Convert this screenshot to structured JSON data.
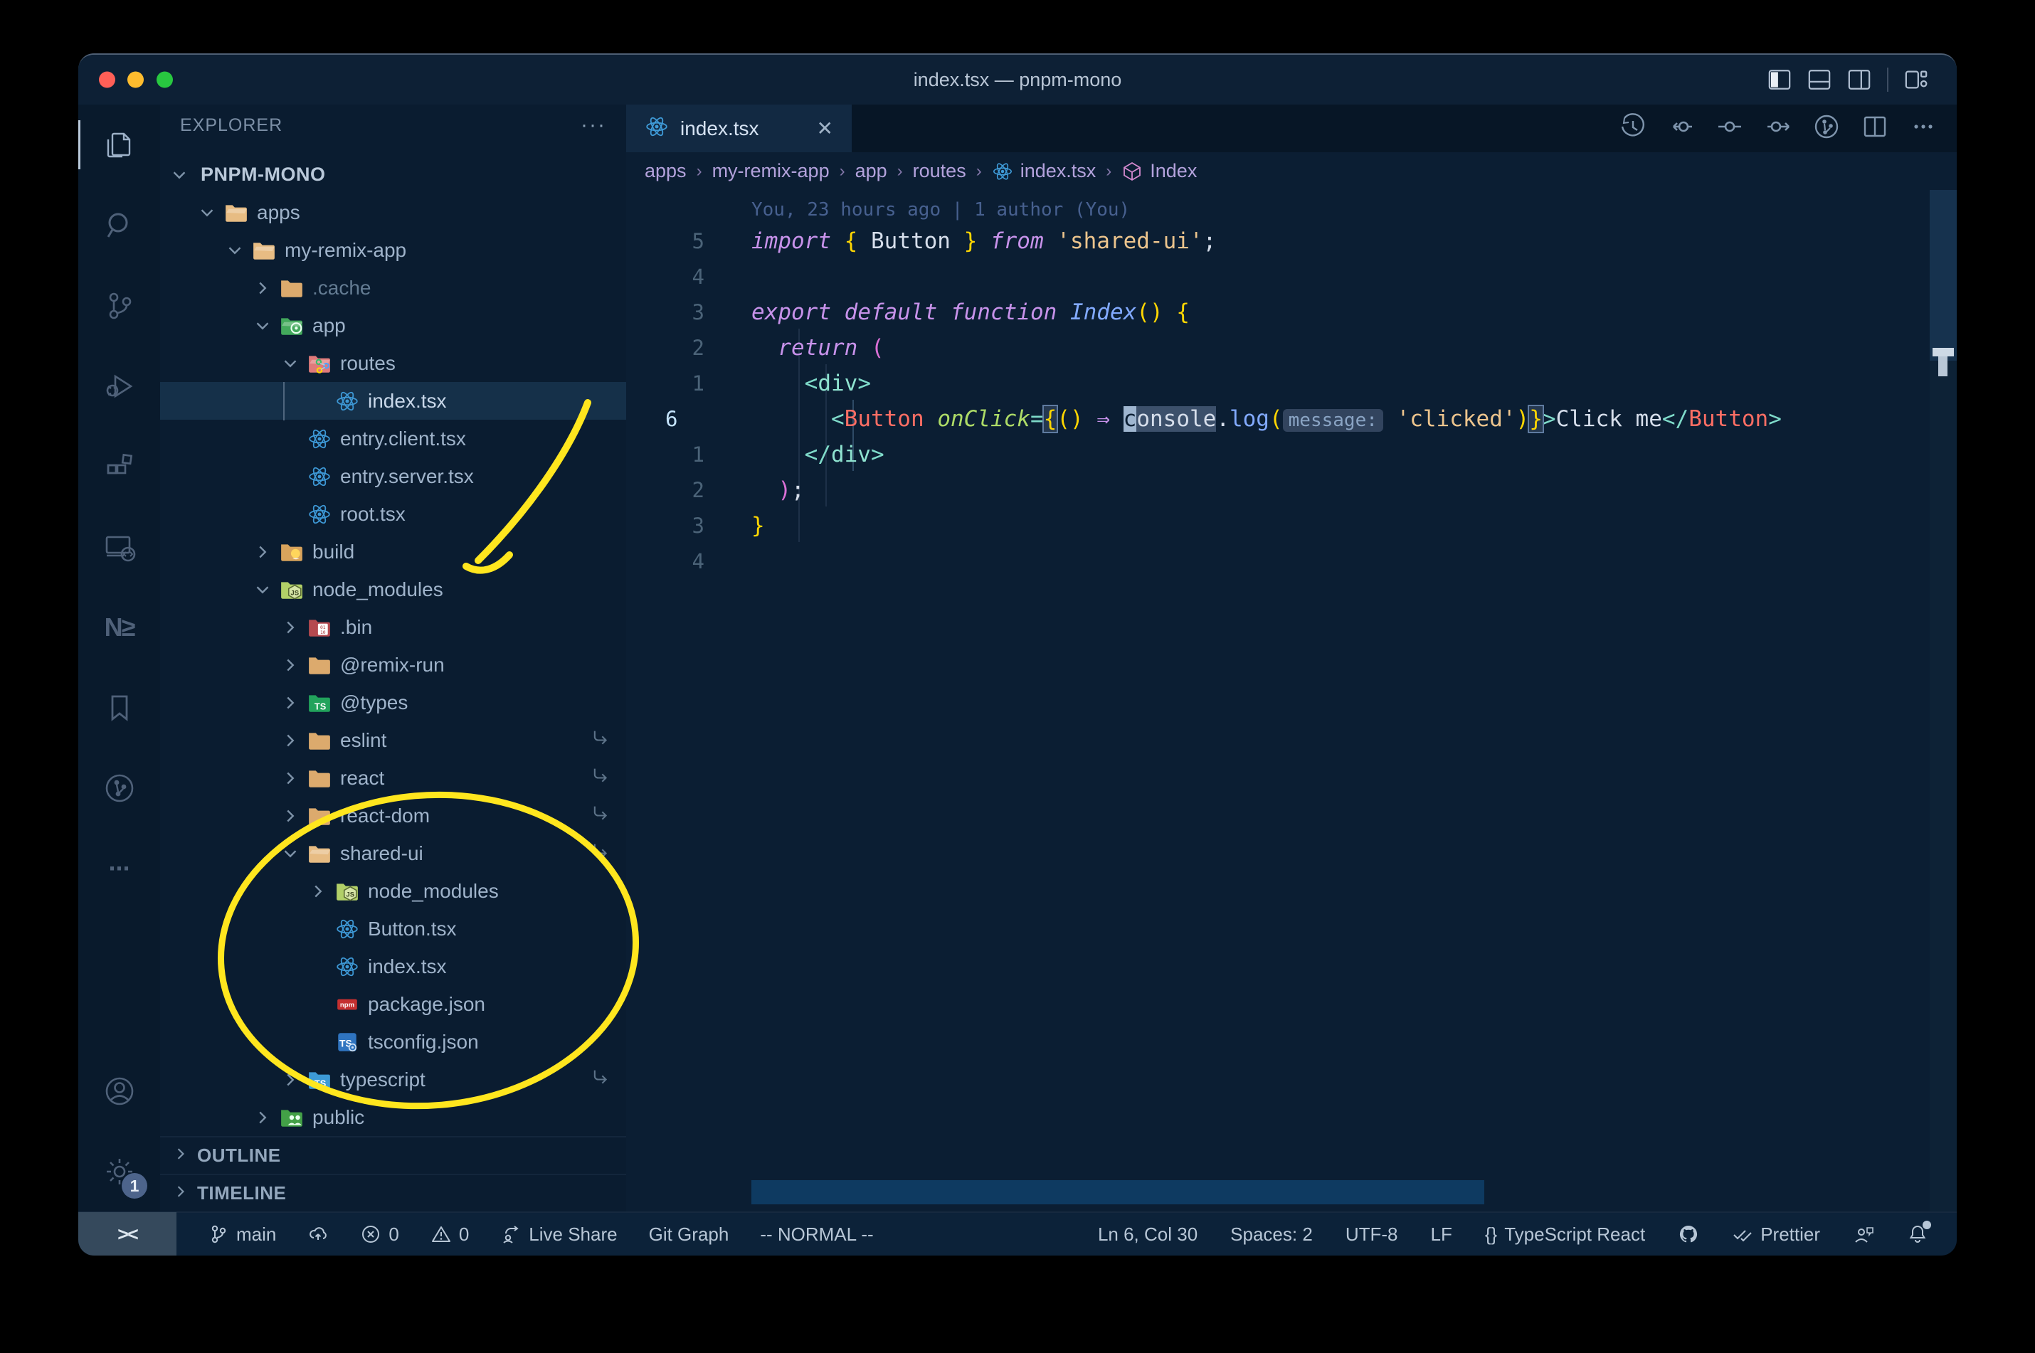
{
  "window": {
    "title": "index.tsx — pnpm-mono"
  },
  "title_bar": {
    "layout_icons": [
      "toggle-primary-sidebar",
      "toggle-panel",
      "toggle-secondary-sidebar",
      "customize-layout"
    ]
  },
  "activity_bar": {
    "items": [
      {
        "id": "explorer",
        "active": true
      },
      {
        "id": "search"
      },
      {
        "id": "source-control"
      },
      {
        "id": "run-debug"
      },
      {
        "id": "extensions"
      },
      {
        "id": "remote-explorer"
      },
      {
        "id": "nx-console",
        "glyph": "N≥"
      },
      {
        "id": "bookmarks"
      },
      {
        "id": "git-graph"
      },
      {
        "id": "more",
        "glyph": "···"
      }
    ],
    "bottom": [
      {
        "id": "accounts"
      },
      {
        "id": "settings",
        "badge": "1"
      }
    ]
  },
  "sidebar": {
    "header": "EXPLORER",
    "more_label": "···",
    "tree": [
      {
        "label": "PNPM-MONO",
        "depth": 0,
        "chevron": "down",
        "icon": null,
        "root": true
      },
      {
        "label": "apps",
        "depth": 1,
        "chevron": "down",
        "icon": "folder-open-tan"
      },
      {
        "label": "my-remix-app",
        "depth": 2,
        "chevron": "down",
        "icon": "folder-open-tan"
      },
      {
        "label": ".cache",
        "depth": 3,
        "chevron": "right",
        "icon": "folder-tan",
        "dimmed": true
      },
      {
        "label": "app",
        "depth": 3,
        "chevron": "down",
        "icon": "folder-app"
      },
      {
        "label": "routes",
        "depth": 4,
        "chevron": "down",
        "icon": "folder-routes"
      },
      {
        "label": "index.tsx",
        "depth": 5,
        "icon": "react",
        "selected": true
      },
      {
        "label": "entry.client.tsx",
        "depth": 4,
        "icon": "react"
      },
      {
        "label": "entry.server.tsx",
        "depth": 4,
        "icon": "react"
      },
      {
        "label": "root.tsx",
        "depth": 4,
        "icon": "react"
      },
      {
        "label": "build",
        "depth": 3,
        "chevron": "right",
        "icon": "folder-build"
      },
      {
        "label": "node_modules",
        "depth": 3,
        "chevron": "down",
        "icon": "folder-nm"
      },
      {
        "label": ".bin",
        "depth": 4,
        "chevron": "right",
        "icon": "folder-bin"
      },
      {
        "label": "@remix-run",
        "depth": 4,
        "chevron": "right",
        "icon": "folder-tan"
      },
      {
        "label": "@types",
        "depth": 4,
        "chevron": "right",
        "icon": "folder-types"
      },
      {
        "label": "eslint",
        "depth": 4,
        "chevron": "right",
        "icon": "folder-tan",
        "symlink": true
      },
      {
        "label": "react",
        "depth": 4,
        "chevron": "right",
        "icon": "folder-tan",
        "symlink": true
      },
      {
        "label": "react-dom",
        "depth": 4,
        "chevron": "right",
        "icon": "folder-tan",
        "symlink": true
      },
      {
        "label": "shared-ui",
        "depth": 4,
        "chevron": "down",
        "icon": "folder-open-tan",
        "symlink": true
      },
      {
        "label": "node_modules",
        "depth": 5,
        "chevron": "right",
        "icon": "folder-nm"
      },
      {
        "label": "Button.tsx",
        "depth": 5,
        "icon": "react"
      },
      {
        "label": "index.tsx",
        "depth": 5,
        "icon": "react"
      },
      {
        "label": "package.json",
        "depth": 5,
        "icon": "npm"
      },
      {
        "label": "tsconfig.json",
        "depth": 5,
        "icon": "tsconfig"
      },
      {
        "label": "typescript",
        "depth": 4,
        "chevron": "right",
        "icon": "folder-ts",
        "symlink": true
      },
      {
        "label": "public",
        "depth": 3,
        "chevron": "right",
        "icon": "folder-public"
      }
    ],
    "sections": [
      {
        "label": "OUTLINE"
      },
      {
        "label": "TIMELINE"
      }
    ]
  },
  "editor": {
    "tab": {
      "label": "index.tsx",
      "icon": "react",
      "close": "✕"
    },
    "toolbar": [
      "timeline",
      "gitlens-back",
      "gitlens-commit",
      "gitlens-forward",
      "git-graph",
      "split-editor",
      "more-actions"
    ],
    "breadcrumbs": [
      {
        "label": "apps"
      },
      {
        "label": "my-remix-app"
      },
      {
        "label": "app"
      },
      {
        "label": "routes"
      },
      {
        "label": "index.tsx",
        "icon": "react"
      },
      {
        "label": "Index",
        "icon": "symbol-module"
      }
    ],
    "blame": "You, 23 hours ago | 1 author (You)",
    "lines": [
      {
        "gutter": "5",
        "tokens": [
          {
            "t": "import",
            "s": "kw"
          },
          {
            "t": " ",
            "s": "p"
          },
          {
            "t": "{ ",
            "s": "b1"
          },
          {
            "t": "Button",
            "s": "var"
          },
          {
            "t": " }",
            "s": "b1"
          },
          {
            "t": " ",
            "s": "p"
          },
          {
            "t": "from",
            "s": "kw"
          },
          {
            "t": " ",
            "s": "p"
          },
          {
            "t": "'shared-ui'",
            "s": "str"
          },
          {
            "t": ";",
            "s": "p"
          }
        ]
      },
      {
        "gutter": "4",
        "tokens": []
      },
      {
        "gutter": "3",
        "tokens": [
          {
            "t": "export",
            "s": "kw"
          },
          {
            "t": " ",
            "s": "p"
          },
          {
            "t": "default",
            "s": "kw"
          },
          {
            "t": " ",
            "s": "p"
          },
          {
            "t": "function",
            "s": "kw"
          },
          {
            "t": " ",
            "s": "p"
          },
          {
            "t": "Index",
            "s": "fn it"
          },
          {
            "t": "()",
            "s": "b1"
          },
          {
            "t": " ",
            "s": "p"
          },
          {
            "t": "{",
            "s": "b1"
          }
        ]
      },
      {
        "gutter": "2",
        "tokens": [
          {
            "t": "  ",
            "s": "p"
          },
          {
            "t": "return",
            "s": "kw"
          },
          {
            "t": " ",
            "s": "p"
          },
          {
            "t": "(",
            "s": "b2"
          }
        ]
      },
      {
        "gutter": "1",
        "tokens": [
          {
            "t": "    ",
            "s": "p"
          },
          {
            "t": "<",
            "s": "tag"
          },
          {
            "t": "div",
            "s": "tagn"
          },
          {
            "t": ">",
            "s": "tag"
          }
        ]
      },
      {
        "gutter": "6",
        "current": true,
        "tokens": [
          {
            "t": "      ",
            "s": "p"
          },
          {
            "t": "<",
            "s": "tag"
          },
          {
            "t": "Button",
            "s": "comp"
          },
          {
            "t": " ",
            "s": "p"
          },
          {
            "t": "onClick",
            "s": "attr"
          },
          {
            "t": "=",
            "s": "tag"
          },
          {
            "t": "{",
            "s": "b1 box"
          },
          {
            "t": "()",
            "s": "b1"
          },
          {
            "t": " ",
            "s": "p"
          },
          {
            "t": "⇒",
            "s": "kw"
          },
          {
            "t": " ",
            "s": "p"
          },
          {
            "t": "c",
            "s": "cursor"
          },
          {
            "t": "onsole",
            "s": "hl"
          },
          {
            "t": ".",
            "s": "p"
          },
          {
            "t": "log",
            "s": "fn"
          },
          {
            "t": "(",
            "s": "b1"
          },
          {
            "t": "message:",
            "s": "inlay"
          },
          {
            "t": " ",
            "s": "p"
          },
          {
            "t": "'clicked'",
            "s": "str"
          },
          {
            "t": ")",
            "s": "b1"
          },
          {
            "t": "}",
            "s": "b1 box"
          },
          {
            "t": ">",
            "s": "tag"
          },
          {
            "t": "Click me",
            "s": "p"
          },
          {
            "t": "</",
            "s": "tag"
          },
          {
            "t": "Button",
            "s": "comp"
          },
          {
            "t": ">",
            "s": "tag"
          }
        ]
      },
      {
        "gutter": "1",
        "tokens": [
          {
            "t": "    ",
            "s": "p"
          },
          {
            "t": "</",
            "s": "tag"
          },
          {
            "t": "div",
            "s": "tagn"
          },
          {
            "t": ">",
            "s": "tag"
          }
        ]
      },
      {
        "gutter": "2",
        "tokens": [
          {
            "t": "  ",
            "s": "p"
          },
          {
            "t": ")",
            "s": "b2"
          },
          {
            "t": ";",
            "s": "p"
          }
        ]
      },
      {
        "gutter": "3",
        "tokens": [
          {
            "t": "}",
            "s": "b1"
          }
        ]
      },
      {
        "gutter": "4",
        "tokens": []
      }
    ]
  },
  "status_bar": {
    "left": [
      {
        "id": "remote",
        "icon": "remote",
        "label": "><"
      },
      {
        "id": "branch",
        "icon": "branch",
        "label": "main"
      },
      {
        "id": "sync",
        "icon": "cloud-upload",
        "label": ""
      },
      {
        "id": "errors",
        "icon": "error",
        "label": "0"
      },
      {
        "id": "warnings",
        "icon": "warning",
        "label": "0"
      },
      {
        "id": "live-share",
        "icon": "live-share",
        "label": "Live Share"
      },
      {
        "id": "git-graph",
        "icon": null,
        "label": "Git Graph"
      },
      {
        "id": "vim-mode",
        "icon": null,
        "label": "-- NORMAL --"
      }
    ],
    "right": [
      {
        "id": "cursor-position",
        "icon": null,
        "label": "Ln 6, Col 30"
      },
      {
        "id": "indentation",
        "icon": null,
        "label": "Spaces: 2"
      },
      {
        "id": "encoding",
        "icon": null,
        "label": "UTF-8"
      },
      {
        "id": "eol",
        "icon": null,
        "label": "LF"
      },
      {
        "id": "language-mode",
        "icon": "braces",
        "label": "TypeScript React"
      },
      {
        "id": "github",
        "icon": "octoface",
        "label": ""
      },
      {
        "id": "formatter",
        "icon": "check-all",
        "label": "Prettier"
      },
      {
        "id": "feedback",
        "icon": "feedback",
        "label": ""
      },
      {
        "id": "notifications",
        "icon": "bell-dot",
        "label": ""
      }
    ]
  },
  "annotations": {
    "color": "#ffe61e",
    "shapes": [
      "hand-drawn-arrow-to-node_modules",
      "hand-drawn-ellipse-around-shared-ui"
    ]
  }
}
